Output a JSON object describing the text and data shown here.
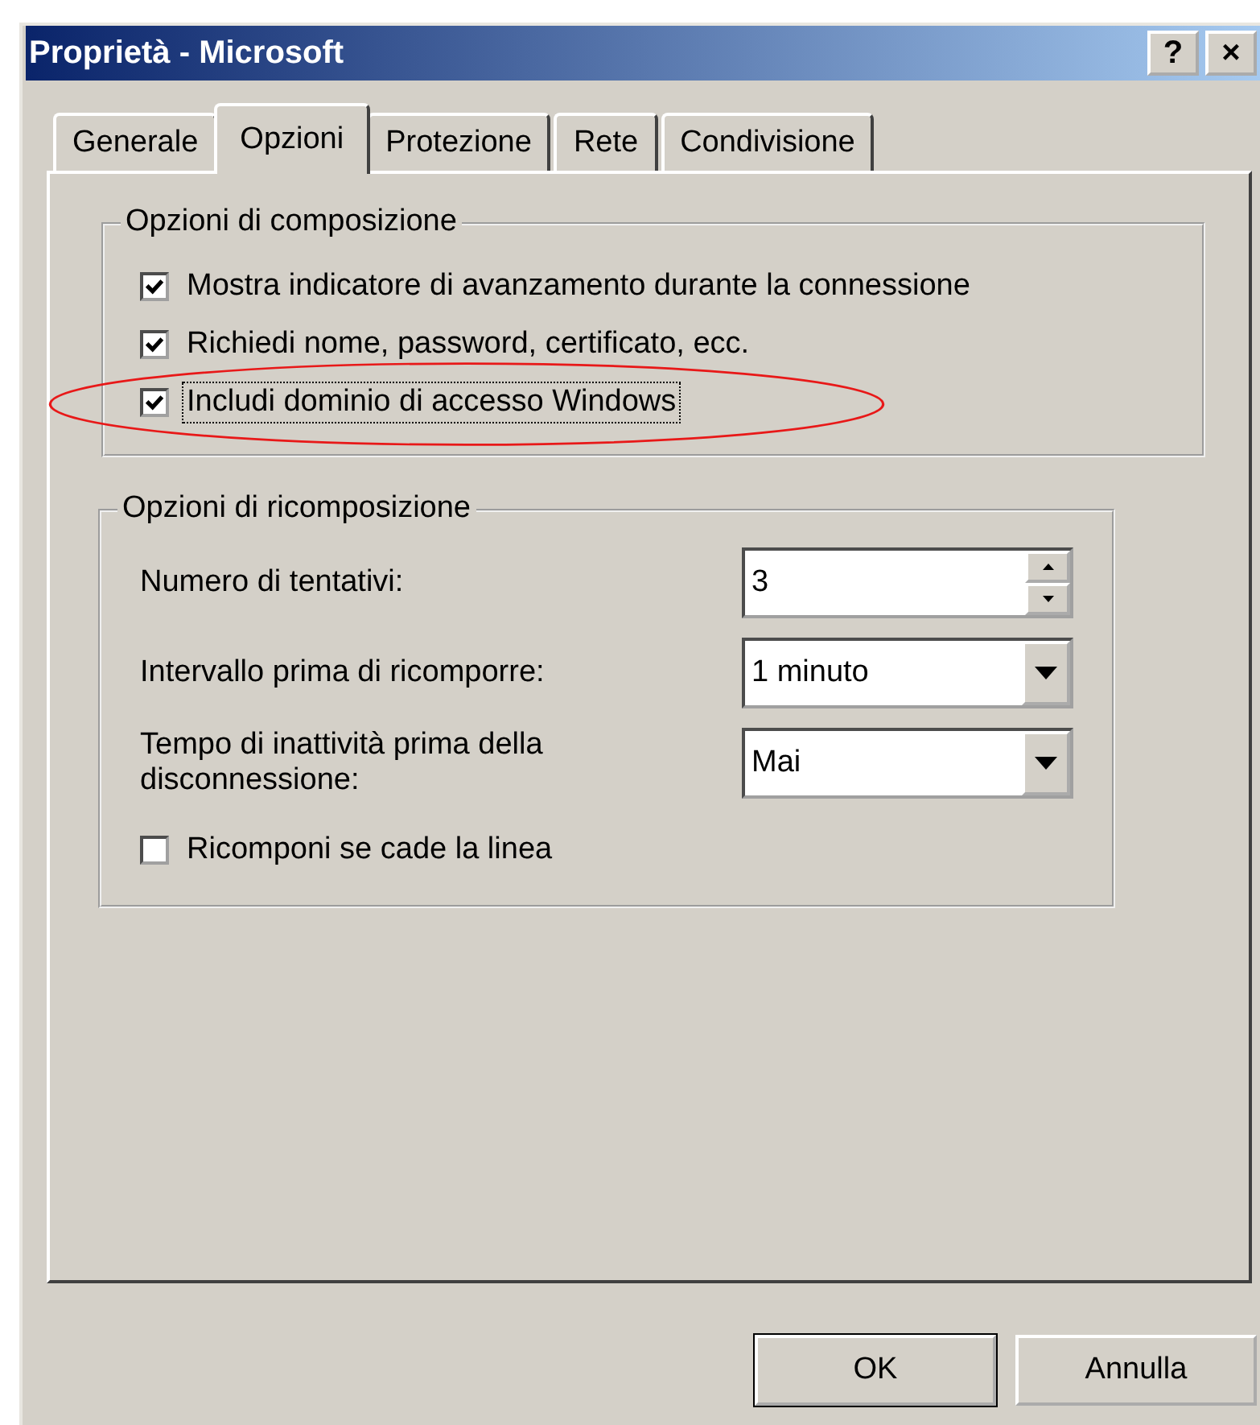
{
  "window": {
    "title": "Proprietà - Microsoft",
    "title_buttons": [
      {
        "kind": "help",
        "label": "?"
      },
      {
        "kind": "close",
        "label": "×"
      }
    ]
  },
  "tabs": [
    {
      "label": "Generale",
      "selected": false
    },
    {
      "label": "Opzioni",
      "selected": true
    },
    {
      "label": "Protezione",
      "selected": false
    },
    {
      "label": "Rete",
      "selected": false
    },
    {
      "label": "Condivisione",
      "selected": false
    }
  ],
  "dial_group": {
    "title": "Opzioni di composizione",
    "options": [
      {
        "label": "Mostra indicatore di avanzamento durante la connessione",
        "checked": true,
        "focused": false,
        "highlighted": false
      },
      {
        "label": "Richiedi nome, password, certificato, ecc.",
        "checked": true,
        "focused": false,
        "highlighted": false
      },
      {
        "label": "Includi dominio di accesso Windows",
        "checked": true,
        "focused": true,
        "highlighted": true
      }
    ]
  },
  "redial_group": {
    "title": "Opzioni di ricomposizione",
    "fields": [
      {
        "kind": "spinner",
        "label": "Numero di tentativi:",
        "value": "3"
      },
      {
        "kind": "dropdown",
        "label": "Intervallo prima di ricomporre:",
        "value": "1 minuto"
      },
      {
        "kind": "dropdown",
        "label": "Tempo di inattività prima della disconnessione:",
        "value": "Mai"
      }
    ],
    "options": [
      {
        "label": "Ricomponi se cade la linea",
        "checked": false
      }
    ]
  },
  "buttons": [
    {
      "label": "OK",
      "default": true
    },
    {
      "label": "Annulla",
      "default": false
    }
  ]
}
